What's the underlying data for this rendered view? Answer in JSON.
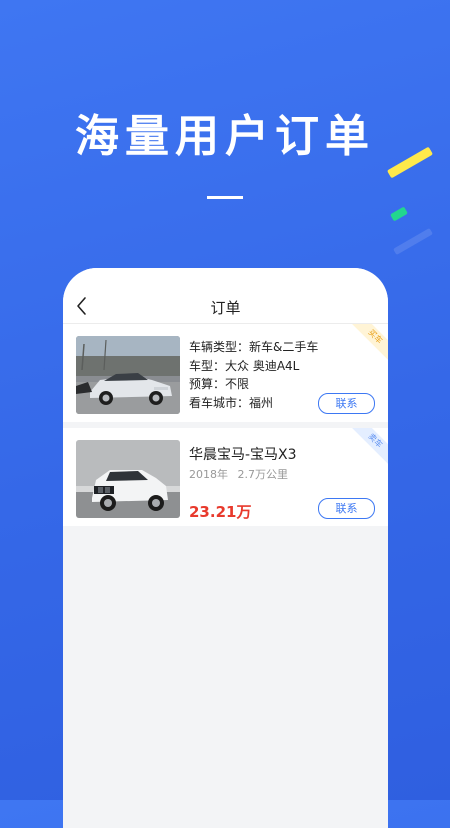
{
  "headline": "海量用户订单",
  "phone": {
    "nav_title": "订单",
    "buy_card": {
      "tag": "买车",
      "type_label": "车辆类型：",
      "type_value": "新车&二手车",
      "model_label": "车型：",
      "model_value": "大众 奥迪A4L",
      "budget_label": "预算：",
      "budget_value": "不限",
      "city_label": "看车城市：",
      "city_value": "福州",
      "contact_label": "联系"
    },
    "sell_card": {
      "tag": "卖车",
      "title": "华晨宝马-宝马X3",
      "year": "2018年",
      "mileage": "2.7万公里",
      "price": "23.21万",
      "contact_label": "联系"
    }
  },
  "colors": {
    "background": "#3568e8",
    "accent": "#3d78f3",
    "price": "#e8392c",
    "stripe_yellow": "#ffe94a",
    "stripe_green": "#22d68e"
  },
  "icons": {
    "back": "chevron-left-icon"
  }
}
